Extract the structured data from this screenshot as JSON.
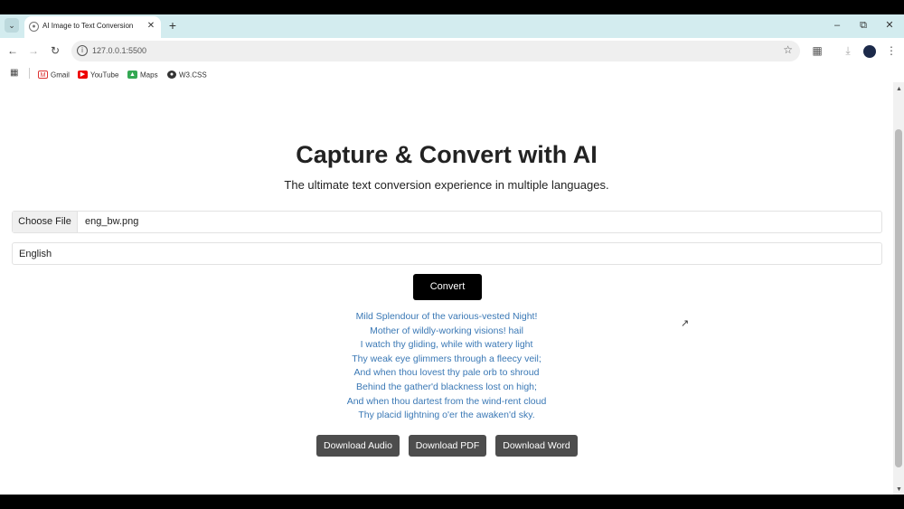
{
  "browser": {
    "tab_title": "AI Image to Text Conversion",
    "url": "127.0.0.1:5500",
    "bookmarks": [
      {
        "label": "Gmail",
        "icon": "gmail-icon"
      },
      {
        "label": "YouTube",
        "icon": "youtube-icon"
      },
      {
        "label": "Maps",
        "icon": "maps-icon"
      },
      {
        "label": "W3.CSS",
        "icon": "w3css-icon"
      }
    ]
  },
  "page": {
    "title": "Capture & Convert with AI",
    "subtitle": "The ultimate text conversion experience in multiple languages.",
    "file_input": {
      "button_label": "Choose File",
      "file_name": "eng_bw.png"
    },
    "language_select": {
      "selected": "English"
    },
    "convert_label": "Convert",
    "output_lines": [
      "Mild Splendour of the various-vested Night!",
      "Mother of wildly-working visions! hail",
      "I watch thy gliding, while with watery light",
      "Thy weak eye glimmers through a fleecy veil;",
      "And when thou lovest thy pale orb to shroud",
      "Behind the gather'd blackness lost on high;",
      "And when thou dartest from the wind-rent cloud",
      "Thy placid lightning o'er the awaken'd sky."
    ],
    "downloads": {
      "audio": "Download Audio",
      "pdf": "Download PDF",
      "word": "Download Word"
    }
  },
  "colors": {
    "output_text": "#3a78b5",
    "convert_button": "#000000",
    "download_button": "#4d4d4d",
    "tab_strip": "#d3ecef"
  }
}
